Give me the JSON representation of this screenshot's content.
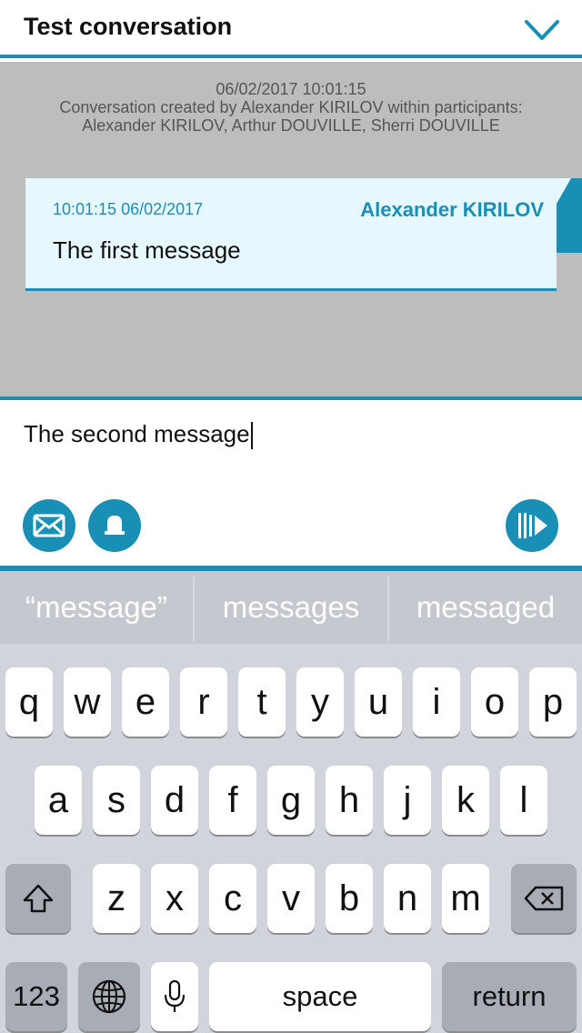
{
  "header": {
    "title": "Test conversation",
    "collapse_icon": "chevron-down-icon"
  },
  "conversation": {
    "system_timestamp": "06/02/2017 10:01:15",
    "system_text": "Conversation created by Alexander KIRILOV within participants: Alexander KIRILOV, Arthur DOUVILLE, Sherri DOUVILLE",
    "messages": [
      {
        "time": "10:01:15 06/02/2017",
        "author": "Alexander KIRILOV",
        "text": "The first message"
      }
    ]
  },
  "composer": {
    "value": "The second message",
    "buttons": {
      "mail_icon": "envelope-icon",
      "bell_icon": "bell-icon",
      "send_icon": "send-icon"
    }
  },
  "keyboard": {
    "suggestions": [
      "“message”",
      "messages",
      "messaged"
    ],
    "row1": [
      "q",
      "w",
      "e",
      "r",
      "t",
      "y",
      "u",
      "i",
      "o",
      "p"
    ],
    "row2": [
      "a",
      "s",
      "d",
      "f",
      "g",
      "h",
      "j",
      "k",
      "l"
    ],
    "row3": [
      "z",
      "x",
      "c",
      "v",
      "b",
      "n",
      "m"
    ],
    "numbers_label": "123",
    "space_label": "space",
    "return_label": "return",
    "icons": {
      "shift": "shift-icon",
      "delete": "backspace-icon",
      "globe": "globe-icon",
      "mic": "microphone-icon"
    }
  },
  "colors": {
    "accent": "#1a8fb5",
    "bubble_bg": "#e6f7fd",
    "conversation_bg": "#bdbdbd",
    "keyboard_bg": "#d1d4da"
  }
}
